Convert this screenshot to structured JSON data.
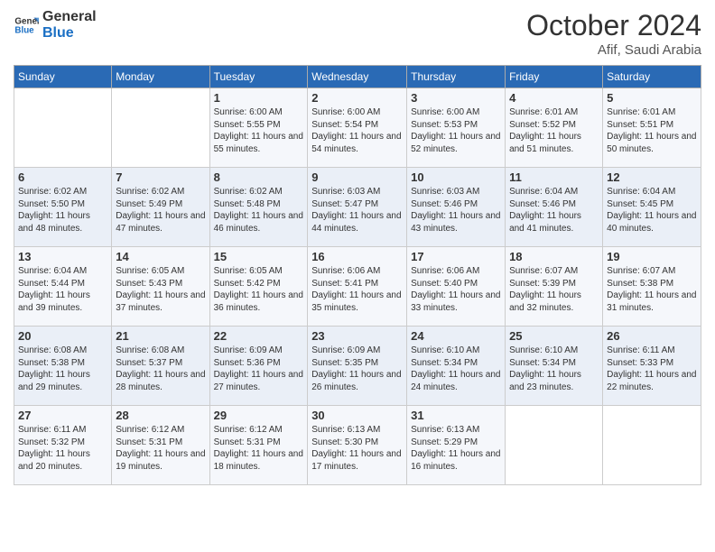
{
  "logo": {
    "line1": "General",
    "line2": "Blue"
  },
  "title": "October 2024",
  "subtitle": "Afif, Saudi Arabia",
  "header_days": [
    "Sunday",
    "Monday",
    "Tuesday",
    "Wednesday",
    "Thursday",
    "Friday",
    "Saturday"
  ],
  "weeks": [
    [
      {
        "day": "",
        "info": ""
      },
      {
        "day": "",
        "info": ""
      },
      {
        "day": "1",
        "sunrise": "Sunrise: 6:00 AM",
        "sunset": "Sunset: 5:55 PM",
        "daylight": "Daylight: 11 hours and 55 minutes."
      },
      {
        "day": "2",
        "sunrise": "Sunrise: 6:00 AM",
        "sunset": "Sunset: 5:54 PM",
        "daylight": "Daylight: 11 hours and 54 minutes."
      },
      {
        "day": "3",
        "sunrise": "Sunrise: 6:00 AM",
        "sunset": "Sunset: 5:53 PM",
        "daylight": "Daylight: 11 hours and 52 minutes."
      },
      {
        "day": "4",
        "sunrise": "Sunrise: 6:01 AM",
        "sunset": "Sunset: 5:52 PM",
        "daylight": "Daylight: 11 hours and 51 minutes."
      },
      {
        "day": "5",
        "sunrise": "Sunrise: 6:01 AM",
        "sunset": "Sunset: 5:51 PM",
        "daylight": "Daylight: 11 hours and 50 minutes."
      }
    ],
    [
      {
        "day": "6",
        "sunrise": "Sunrise: 6:02 AM",
        "sunset": "Sunset: 5:50 PM",
        "daylight": "Daylight: 11 hours and 48 minutes."
      },
      {
        "day": "7",
        "sunrise": "Sunrise: 6:02 AM",
        "sunset": "Sunset: 5:49 PM",
        "daylight": "Daylight: 11 hours and 47 minutes."
      },
      {
        "day": "8",
        "sunrise": "Sunrise: 6:02 AM",
        "sunset": "Sunset: 5:48 PM",
        "daylight": "Daylight: 11 hours and 46 minutes."
      },
      {
        "day": "9",
        "sunrise": "Sunrise: 6:03 AM",
        "sunset": "Sunset: 5:47 PM",
        "daylight": "Daylight: 11 hours and 44 minutes."
      },
      {
        "day": "10",
        "sunrise": "Sunrise: 6:03 AM",
        "sunset": "Sunset: 5:46 PM",
        "daylight": "Daylight: 11 hours and 43 minutes."
      },
      {
        "day": "11",
        "sunrise": "Sunrise: 6:04 AM",
        "sunset": "Sunset: 5:46 PM",
        "daylight": "Daylight: 11 hours and 41 minutes."
      },
      {
        "day": "12",
        "sunrise": "Sunrise: 6:04 AM",
        "sunset": "Sunset: 5:45 PM",
        "daylight": "Daylight: 11 hours and 40 minutes."
      }
    ],
    [
      {
        "day": "13",
        "sunrise": "Sunrise: 6:04 AM",
        "sunset": "Sunset: 5:44 PM",
        "daylight": "Daylight: 11 hours and 39 minutes."
      },
      {
        "day": "14",
        "sunrise": "Sunrise: 6:05 AM",
        "sunset": "Sunset: 5:43 PM",
        "daylight": "Daylight: 11 hours and 37 minutes."
      },
      {
        "day": "15",
        "sunrise": "Sunrise: 6:05 AM",
        "sunset": "Sunset: 5:42 PM",
        "daylight": "Daylight: 11 hours and 36 minutes."
      },
      {
        "day": "16",
        "sunrise": "Sunrise: 6:06 AM",
        "sunset": "Sunset: 5:41 PM",
        "daylight": "Daylight: 11 hours and 35 minutes."
      },
      {
        "day": "17",
        "sunrise": "Sunrise: 6:06 AM",
        "sunset": "Sunset: 5:40 PM",
        "daylight": "Daylight: 11 hours and 33 minutes."
      },
      {
        "day": "18",
        "sunrise": "Sunrise: 6:07 AM",
        "sunset": "Sunset: 5:39 PM",
        "daylight": "Daylight: 11 hours and 32 minutes."
      },
      {
        "day": "19",
        "sunrise": "Sunrise: 6:07 AM",
        "sunset": "Sunset: 5:38 PM",
        "daylight": "Daylight: 11 hours and 31 minutes."
      }
    ],
    [
      {
        "day": "20",
        "sunrise": "Sunrise: 6:08 AM",
        "sunset": "Sunset: 5:38 PM",
        "daylight": "Daylight: 11 hours and 29 minutes."
      },
      {
        "day": "21",
        "sunrise": "Sunrise: 6:08 AM",
        "sunset": "Sunset: 5:37 PM",
        "daylight": "Daylight: 11 hours and 28 minutes."
      },
      {
        "day": "22",
        "sunrise": "Sunrise: 6:09 AM",
        "sunset": "Sunset: 5:36 PM",
        "daylight": "Daylight: 11 hours and 27 minutes."
      },
      {
        "day": "23",
        "sunrise": "Sunrise: 6:09 AM",
        "sunset": "Sunset: 5:35 PM",
        "daylight": "Daylight: 11 hours and 26 minutes."
      },
      {
        "day": "24",
        "sunrise": "Sunrise: 6:10 AM",
        "sunset": "Sunset: 5:34 PM",
        "daylight": "Daylight: 11 hours and 24 minutes."
      },
      {
        "day": "25",
        "sunrise": "Sunrise: 6:10 AM",
        "sunset": "Sunset: 5:34 PM",
        "daylight": "Daylight: 11 hours and 23 minutes."
      },
      {
        "day": "26",
        "sunrise": "Sunrise: 6:11 AM",
        "sunset": "Sunset: 5:33 PM",
        "daylight": "Daylight: 11 hours and 22 minutes."
      }
    ],
    [
      {
        "day": "27",
        "sunrise": "Sunrise: 6:11 AM",
        "sunset": "Sunset: 5:32 PM",
        "daylight": "Daylight: 11 hours and 20 minutes."
      },
      {
        "day": "28",
        "sunrise": "Sunrise: 6:12 AM",
        "sunset": "Sunset: 5:31 PM",
        "daylight": "Daylight: 11 hours and 19 minutes."
      },
      {
        "day": "29",
        "sunrise": "Sunrise: 6:12 AM",
        "sunset": "Sunset: 5:31 PM",
        "daylight": "Daylight: 11 hours and 18 minutes."
      },
      {
        "day": "30",
        "sunrise": "Sunrise: 6:13 AM",
        "sunset": "Sunset: 5:30 PM",
        "daylight": "Daylight: 11 hours and 17 minutes."
      },
      {
        "day": "31",
        "sunrise": "Sunrise: 6:13 AM",
        "sunset": "Sunset: 5:29 PM",
        "daylight": "Daylight: 11 hours and 16 minutes."
      },
      {
        "day": "",
        "info": ""
      },
      {
        "day": "",
        "info": ""
      }
    ]
  ]
}
